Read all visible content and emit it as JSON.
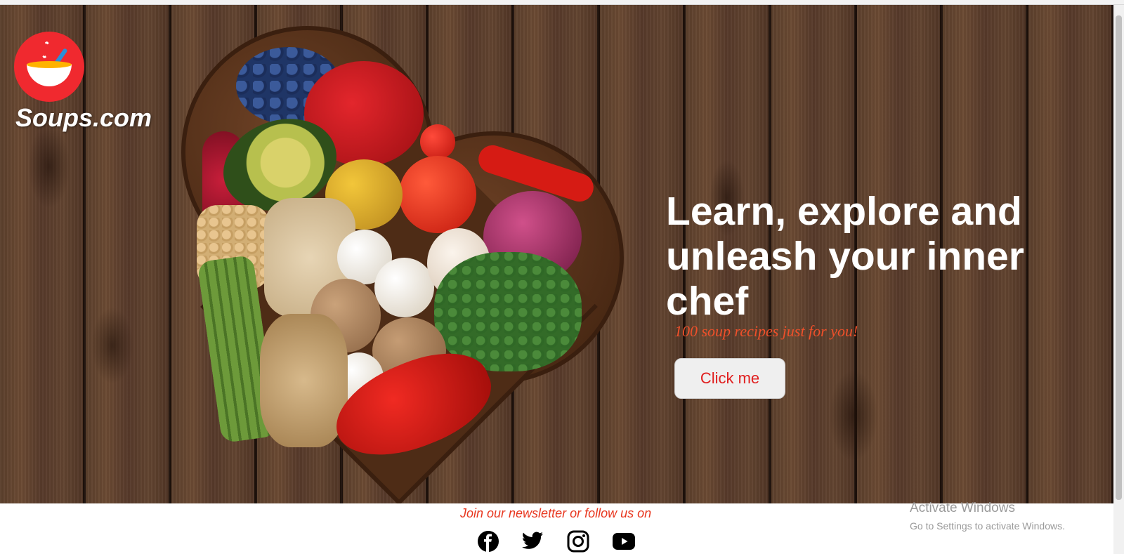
{
  "site": {
    "name": "Soups.com",
    "logo_icon": "soup-bowl-icon",
    "logo_color": "#f0292f"
  },
  "hero": {
    "headline": "Learn, explore and unleash your inner chef",
    "subline": "100 soup recipes just for you!",
    "cta_label": "Click me",
    "cta_text_color": "#e02020",
    "subline_color": "#f0502a"
  },
  "footer": {
    "newsletter_text": "Join our newsletter or follow us on",
    "socials": [
      "facebook-icon",
      "twitter-icon",
      "instagram-icon",
      "youtube-icon"
    ]
  },
  "watermark": {
    "title": "Activate Windows",
    "subtitle": "Go to Settings to activate Windows."
  }
}
